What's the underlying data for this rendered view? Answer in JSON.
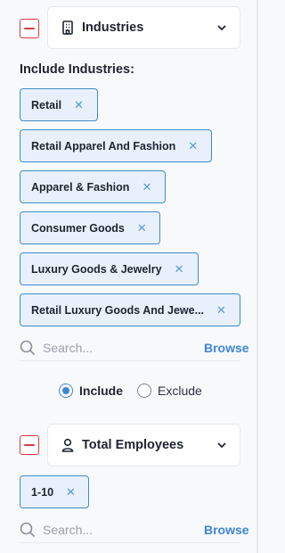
{
  "industries": {
    "title": "Industries",
    "include_label": "Include Industries:",
    "tags": [
      "Retail",
      "Retail Apparel And Fashion",
      "Apparel & Fashion",
      "Consumer Goods",
      "Luxury Goods & Jewelry",
      "Retail Luxury Goods And Jewe..."
    ],
    "search_placeholder": "Search...",
    "browse_label": "Browse",
    "include_option": "Include",
    "exclude_option": "Exclude",
    "selected_option": "Include"
  },
  "employees": {
    "title": "Total Employees",
    "tags": [
      "1-10"
    ],
    "search_placeholder": "Search...",
    "browse_label": "Browse"
  },
  "colors": {
    "accent": "#3d86d6",
    "danger": "#d93b3b",
    "tag_bg": "#e8f1fb",
    "tag_border": "#3f8cc7"
  },
  "icons": {
    "industries": "building-icon",
    "employees": "user-icon",
    "collapse": "minus-icon",
    "expand": "chevron-down-icon",
    "search": "search-icon",
    "remove": "close-icon"
  }
}
